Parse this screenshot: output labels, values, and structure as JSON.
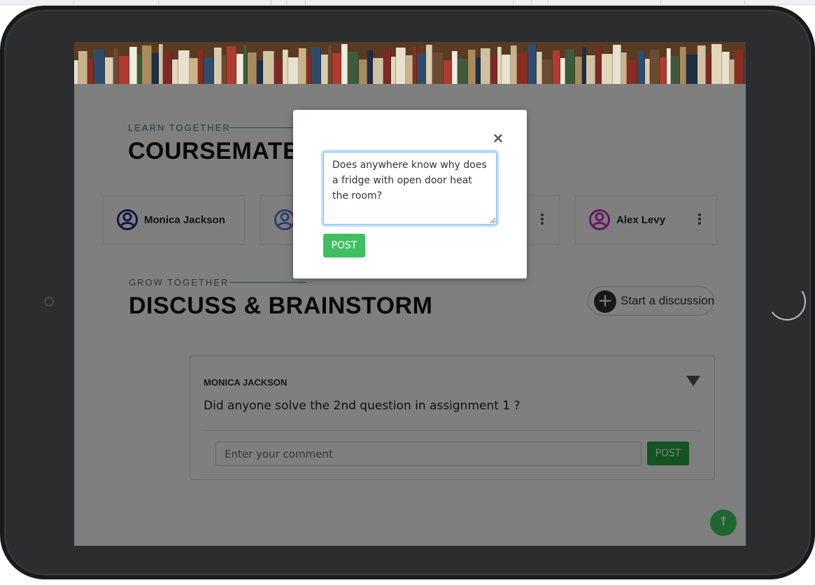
{
  "colors": {
    "accent_green": "#28a745",
    "scroll_top_green": "#3fcf64",
    "avatar_navy": "#1f2a8a",
    "avatar_blue": "#6b79d6",
    "avatar_magenta": "#d12ac9",
    "overlay": "rgba(0,0,0,0.5)"
  },
  "coursemates_section": {
    "kicker": "LEARN TOGETHER",
    "title": "COURSEMATES",
    "mates": [
      {
        "name": "Monica Jackson",
        "avatar_icon": "user-circle-icon",
        "color": "#1f2a8a",
        "has_menu": false
      },
      {
        "name": "",
        "avatar_icon": "user-circle-icon",
        "color": "#6b79d6",
        "has_menu": false
      },
      {
        "name": "",
        "avatar_icon": "user-circle-icon",
        "color": "",
        "has_menu": true
      },
      {
        "name": "Alex Levy",
        "avatar_icon": "user-circle-icon",
        "color": "#d12ac9",
        "has_menu": true
      }
    ]
  },
  "discuss_section": {
    "kicker": "GROW TOGETHER",
    "title": "DISCUSS & BRAINSTORM",
    "start_button": {
      "icon": "plus-circle-icon",
      "label": "Start a discussion"
    }
  },
  "post": {
    "author": "MONICA JACKSON",
    "text": "Did anyone solve the 2nd question in assignment 1 ?",
    "toggle_icon": "caret-down-icon",
    "comment_placeholder": "Enter your comment",
    "post_label": "POST"
  },
  "scroll_top": {
    "icon": "arrow-up-icon",
    "glyph": "↑"
  },
  "modal": {
    "close_glyph": "×",
    "close_icon": "close-icon",
    "textarea_value": "Does anywhere know why does a fridge with open door heat the room?",
    "post_label": "POST"
  }
}
